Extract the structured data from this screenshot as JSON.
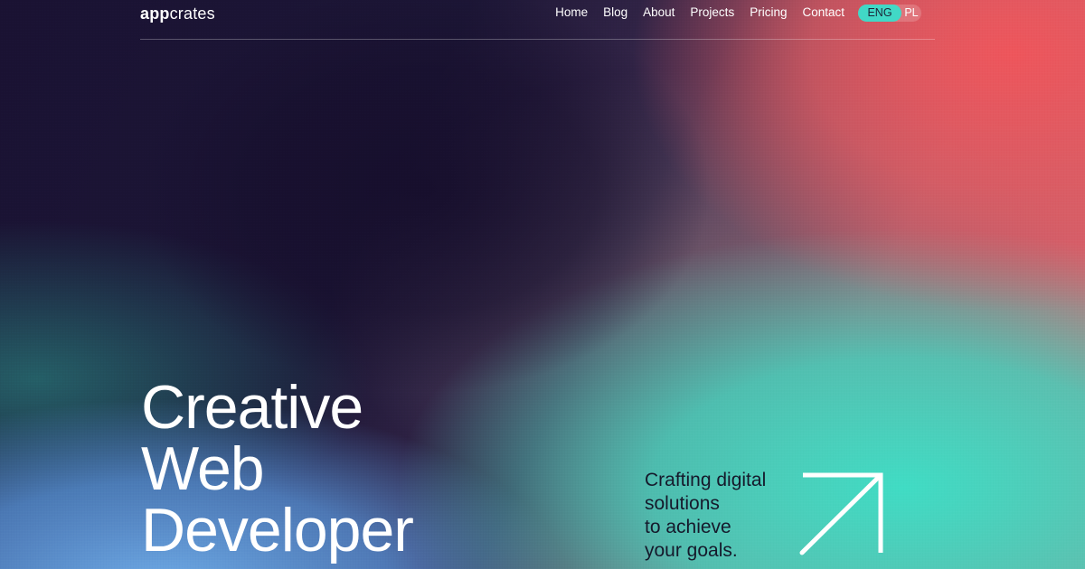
{
  "brand": {
    "logo_bold": "app",
    "logo_light": "crates"
  },
  "nav": {
    "items": [
      {
        "label": "Home"
      },
      {
        "label": "Blog"
      },
      {
        "label": "About"
      },
      {
        "label": "Projects"
      },
      {
        "label": "Pricing"
      },
      {
        "label": "Contact"
      }
    ],
    "language": {
      "active": "ENG",
      "inactive": "PL"
    }
  },
  "hero": {
    "title_lines": [
      "Creative",
      "Web",
      "Developer"
    ],
    "tagline_lines": [
      "Crafting digital",
      "solutions",
      "to achieve",
      "your goals."
    ],
    "cta_icon": "arrow-up-right-icon"
  },
  "colors": {
    "accent": "#41d8c6",
    "coral": "#e6636a",
    "navy": "#1a1233",
    "text_dark": "#15192b"
  }
}
